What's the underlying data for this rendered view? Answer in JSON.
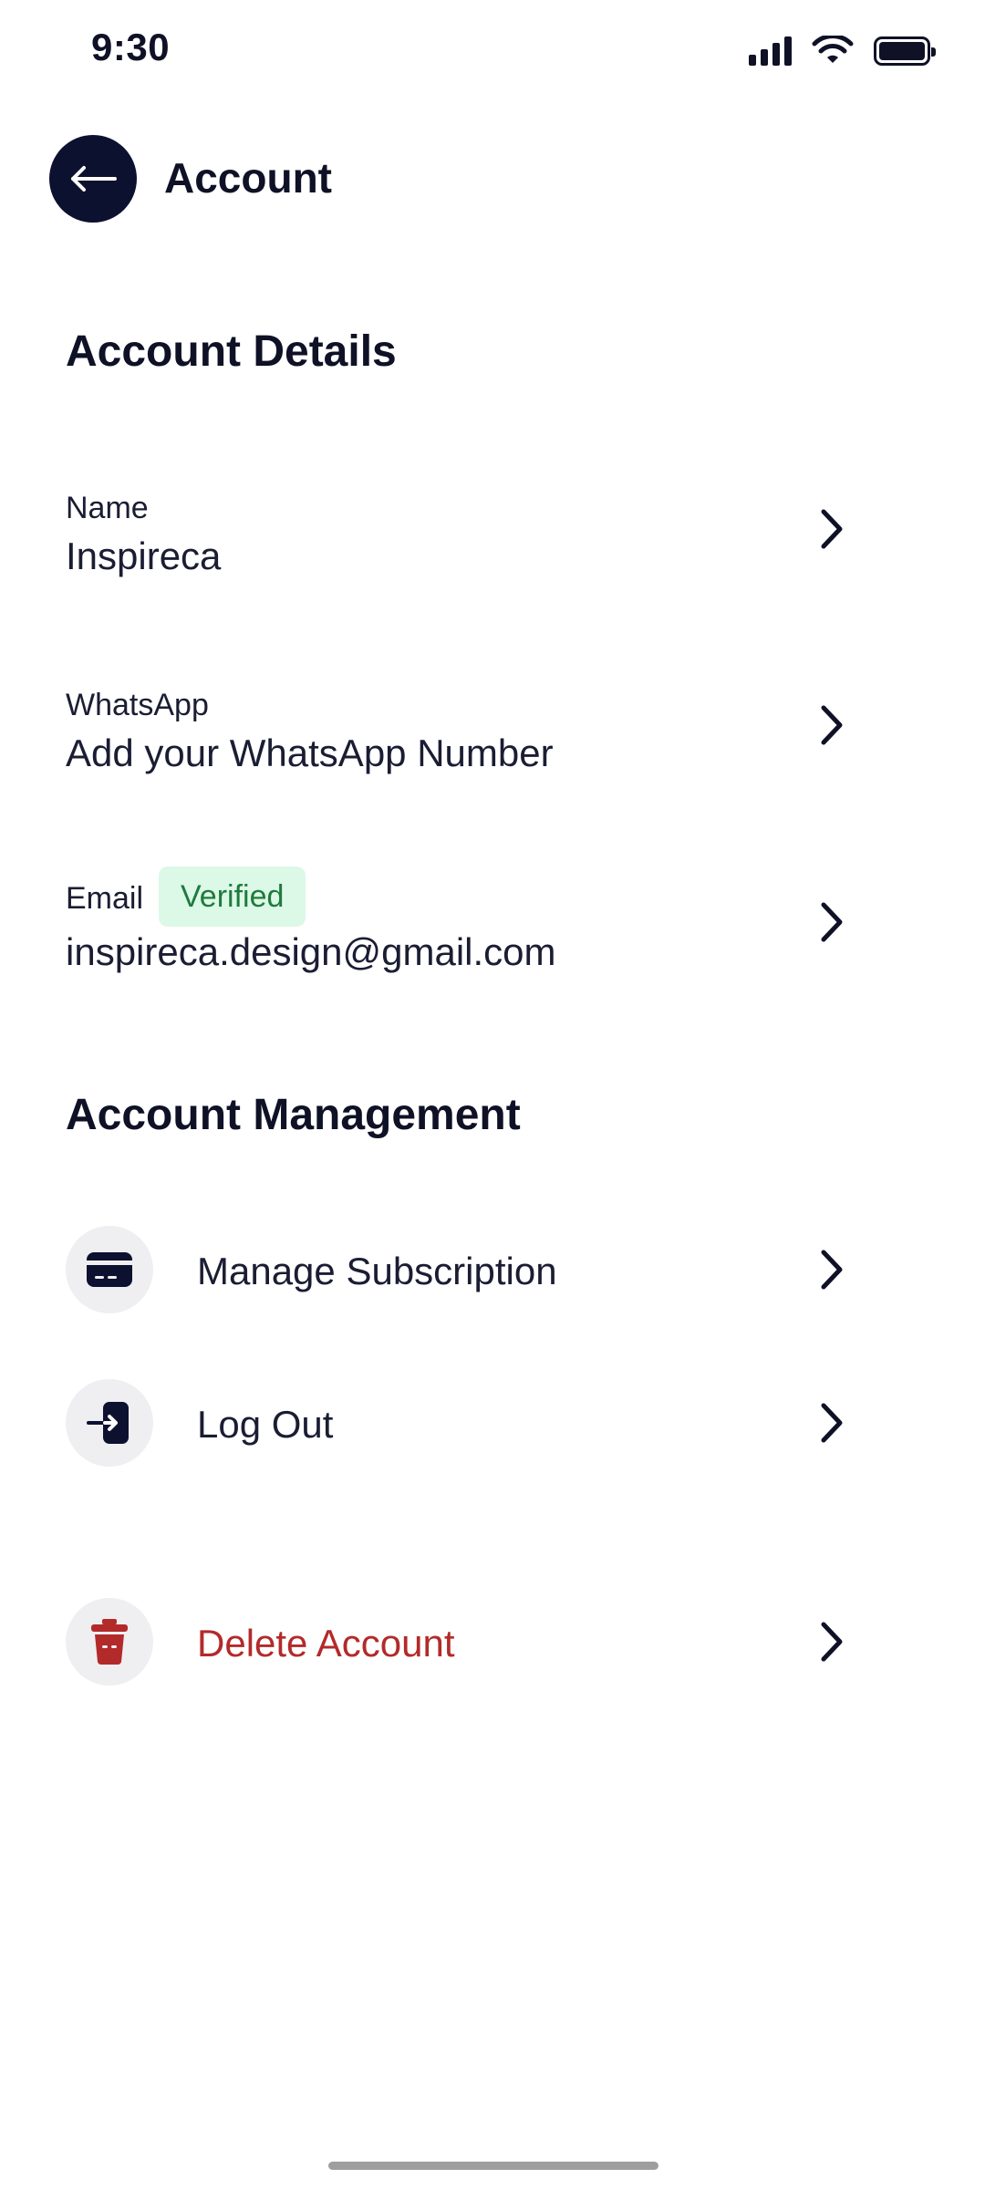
{
  "status_bar": {
    "time": "9:30"
  },
  "header": {
    "title": "Account"
  },
  "account_details": {
    "title": "Account Details",
    "name": {
      "label": "Name",
      "value": "Inspireca"
    },
    "whatsapp": {
      "label": "WhatsApp",
      "value": "Add your WhatsApp Number"
    },
    "email": {
      "label": "Email",
      "badge": "Verified",
      "value": "inspireca.design@gmail.com"
    }
  },
  "account_management": {
    "title": "Account Management",
    "items": [
      {
        "label": "Manage Subscription",
        "icon": "card-icon"
      },
      {
        "label": "Log Out",
        "icon": "logout-icon"
      },
      {
        "label": "Delete Account",
        "icon": "trash-icon"
      }
    ]
  },
  "colors": {
    "primary": "#0d1130",
    "danger": "#b32a2a",
    "badge_bg": "#dcf8e6",
    "badge_text": "#1f7a3d"
  }
}
